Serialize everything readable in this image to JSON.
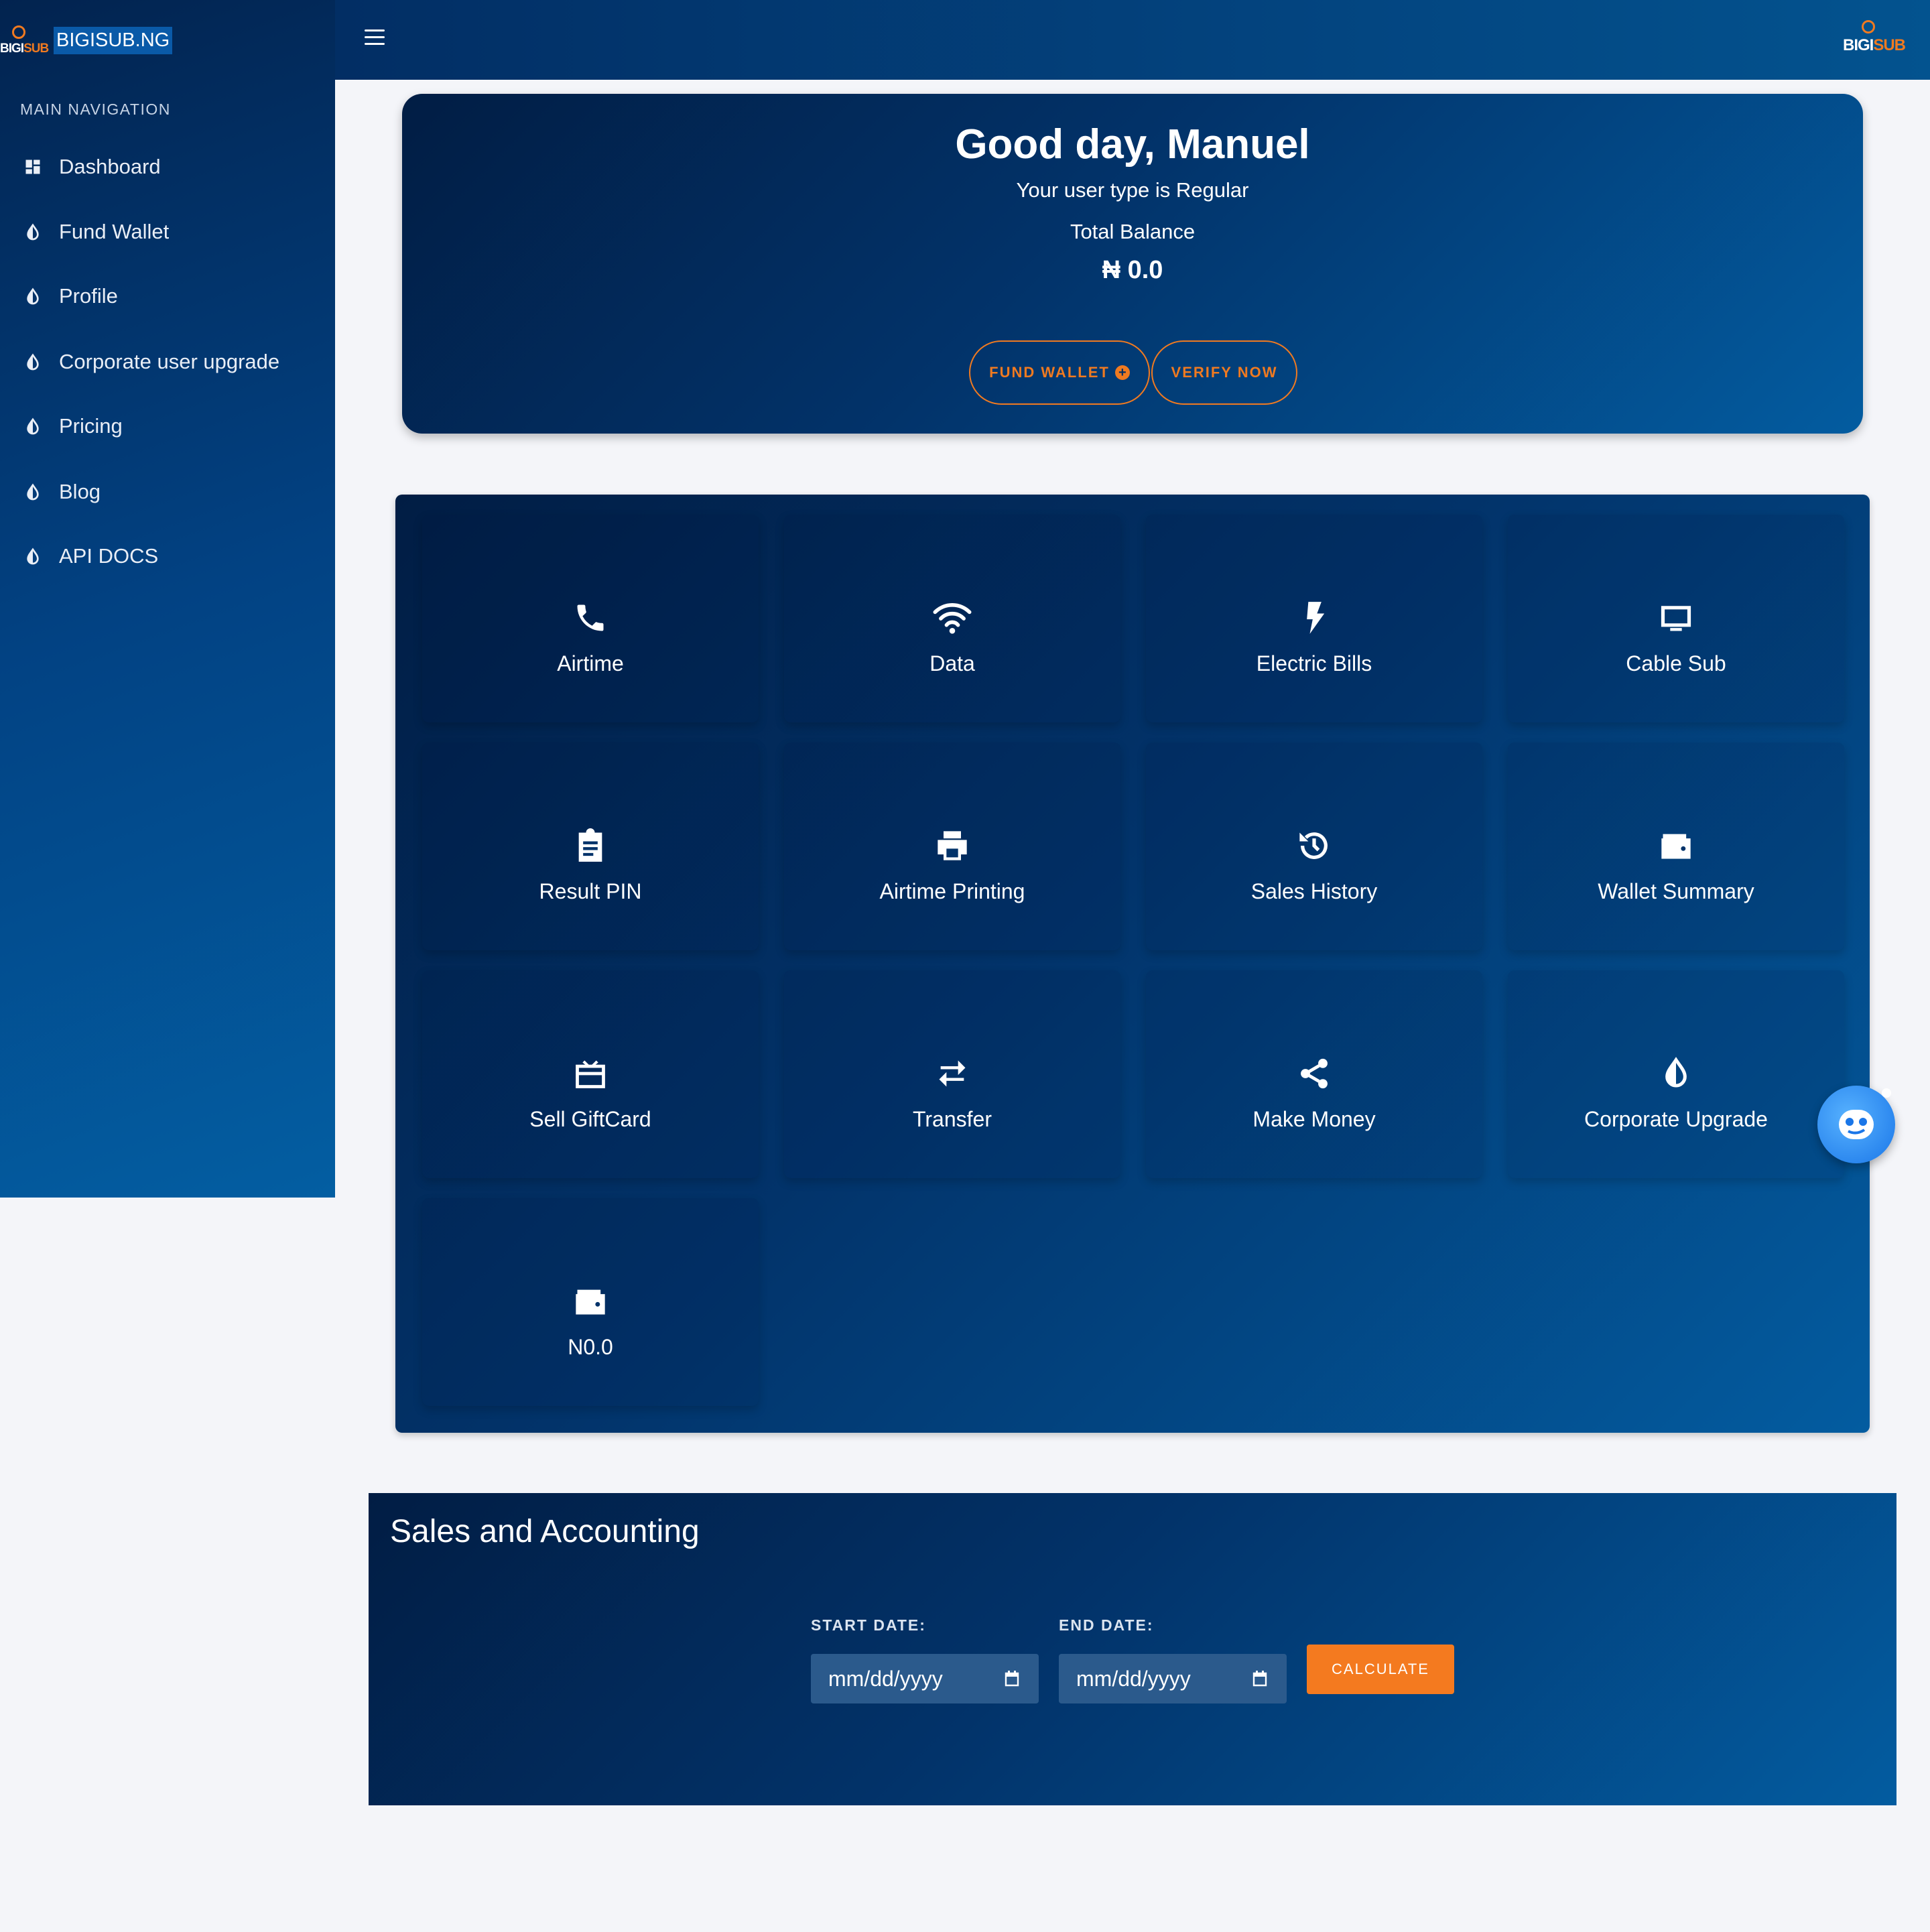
{
  "brand": {
    "logo_text_white": "BIGI",
    "logo_text_orange": "SUB",
    "name": "BIGISUB.NG"
  },
  "sidebar": {
    "header": "MAIN NAVIGATION",
    "items": [
      {
        "label": "Dashboard",
        "icon": "dashboard-icon"
      },
      {
        "label": "Fund Wallet",
        "icon": "drop-icon"
      },
      {
        "label": "Profile",
        "icon": "drop-icon"
      },
      {
        "label": "Corporate user upgrade",
        "icon": "drop-icon"
      },
      {
        "label": "Pricing",
        "icon": "drop-icon"
      },
      {
        "label": "Blog",
        "icon": "drop-icon"
      },
      {
        "label": "API DOCS",
        "icon": "drop-icon"
      }
    ]
  },
  "topbar": {
    "menu_icon": "hamburger-icon",
    "logo_text_white": "BIGI",
    "logo_text_orange": "SUB"
  },
  "welcome": {
    "greeting": "Good day, Manuel",
    "user_type": "Your user type is Regular",
    "balance_label": "Total Balance",
    "balance_value": "₦ 0.0",
    "fund_wallet_label": "FUND WALLET",
    "verify_label": "VERIFY NOW"
  },
  "services": [
    {
      "label": "Airtime",
      "icon": "phone-icon"
    },
    {
      "label": "Data",
      "icon": "wifi-icon"
    },
    {
      "label": "Electric Bills",
      "icon": "bolt-icon"
    },
    {
      "label": "Cable Sub",
      "icon": "tv-icon"
    },
    {
      "label": "Result PIN",
      "icon": "clipboard-icon"
    },
    {
      "label": "Airtime Printing",
      "icon": "printer-icon"
    },
    {
      "label": "Sales History",
      "icon": "history-icon"
    },
    {
      "label": "Wallet Summary",
      "icon": "wallet-icon"
    },
    {
      "label": "Sell GiftCard",
      "icon": "giftcard-icon"
    },
    {
      "label": "Transfer",
      "icon": "transfer-icon"
    },
    {
      "label": "Make Money",
      "icon": "share-icon"
    },
    {
      "label": "Corporate Upgrade",
      "icon": "drop-icon"
    },
    {
      "label": "N0.0",
      "icon": "wallet-icon"
    }
  ],
  "sales": {
    "title": "Sales and Accounting",
    "start_label": "START DATE:",
    "end_label": "END DATE:",
    "start_placeholder": "mm/dd/yyyy",
    "end_placeholder": "mm/dd/yyyy",
    "calculate_label": "CALCULATE"
  },
  "colors": {
    "accent": "#f07a20",
    "primary_dark": "#011d44",
    "primary_light": "#035ca0",
    "background": "#f4f5f9"
  }
}
